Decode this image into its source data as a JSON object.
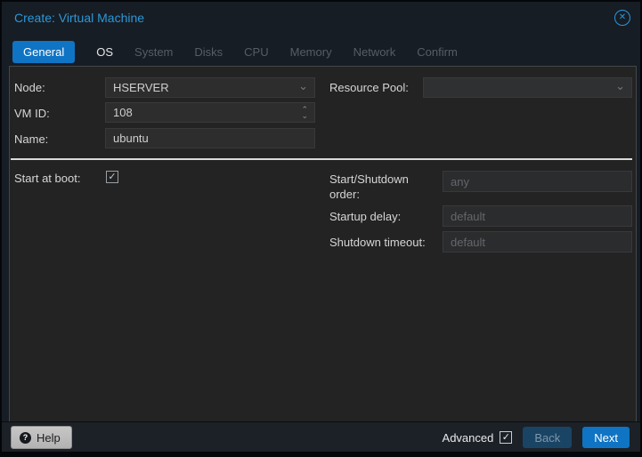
{
  "window": {
    "title": "Create: Virtual Machine"
  },
  "tabs": [
    {
      "label": "General",
      "state": "active"
    },
    {
      "label": "OS",
      "state": "enabled"
    },
    {
      "label": "System",
      "state": "disabled"
    },
    {
      "label": "Disks",
      "state": "disabled"
    },
    {
      "label": "CPU",
      "state": "disabled"
    },
    {
      "label": "Memory",
      "state": "disabled"
    },
    {
      "label": "Network",
      "state": "disabled"
    },
    {
      "label": "Confirm",
      "state": "disabled"
    }
  ],
  "form": {
    "node": {
      "label": "Node:",
      "value": "HSERVER"
    },
    "resource_pool": {
      "label": "Resource Pool:",
      "value": ""
    },
    "vm_id": {
      "label": "VM ID:",
      "value": "108"
    },
    "name": {
      "label": "Name:",
      "value": "ubuntu"
    },
    "start_at_boot": {
      "label": "Start at boot:",
      "checked": true
    },
    "start_shutdown_order": {
      "label": "Start/Shutdown order:",
      "value": "",
      "placeholder": "any"
    },
    "startup_delay": {
      "label": "Startup delay:",
      "value": "",
      "placeholder": "default"
    },
    "shutdown_timeout": {
      "label": "Shutdown timeout:",
      "value": "",
      "placeholder": "default"
    }
  },
  "footer": {
    "help": "Help",
    "advanced": "Advanced",
    "advanced_checked": true,
    "back": "Back",
    "next": "Next"
  },
  "icons": {
    "close": "✕",
    "chevron_down": "⌄",
    "spinner_up": "⌃",
    "spinner_down": "⌄",
    "help_glyph": "?",
    "check": "✓"
  },
  "colors": {
    "accent_blue": "#0f74c4",
    "title_blue": "#2b97d8",
    "panel_bg": "#232324",
    "field_bg": "#2d2d2e",
    "back_button_bg": "#1a4464",
    "separator": "#dadada"
  }
}
